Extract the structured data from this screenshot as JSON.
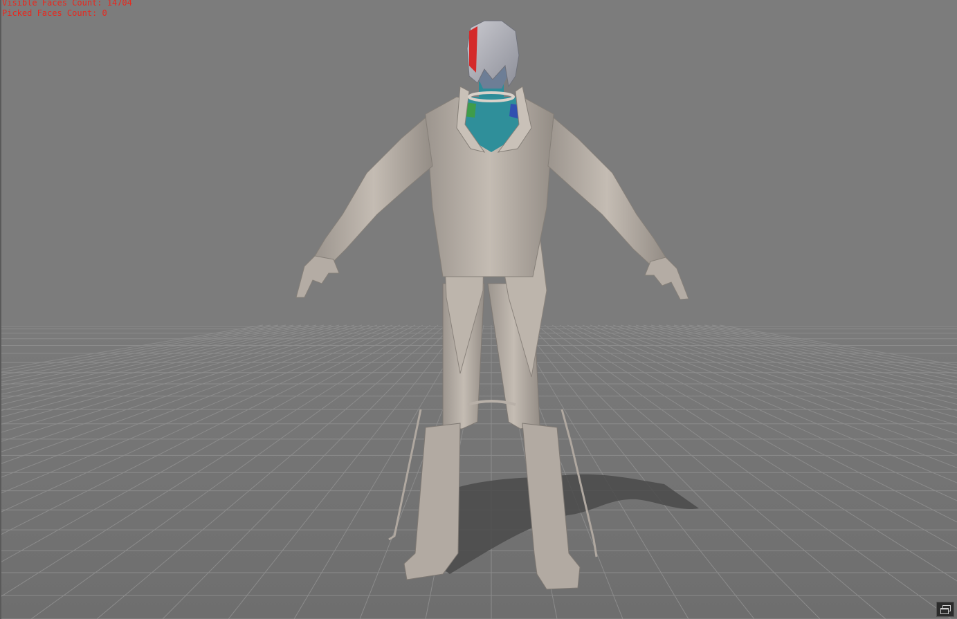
{
  "overlay": {
    "visible_faces": "Visible Faces Count: 14704",
    "picked_faces": "Picked Faces Count: 0"
  },
  "colors": {
    "background": "#7c7c7c",
    "grid_floor": "#6f6f6f",
    "grid_line": "#8a8a8a",
    "overlay_text": "#e8281e",
    "model_base": "#b8b0a8",
    "skin_highlight": "#2f8f9a"
  },
  "icons": {
    "restore_viewport": "restore-window-icon"
  }
}
